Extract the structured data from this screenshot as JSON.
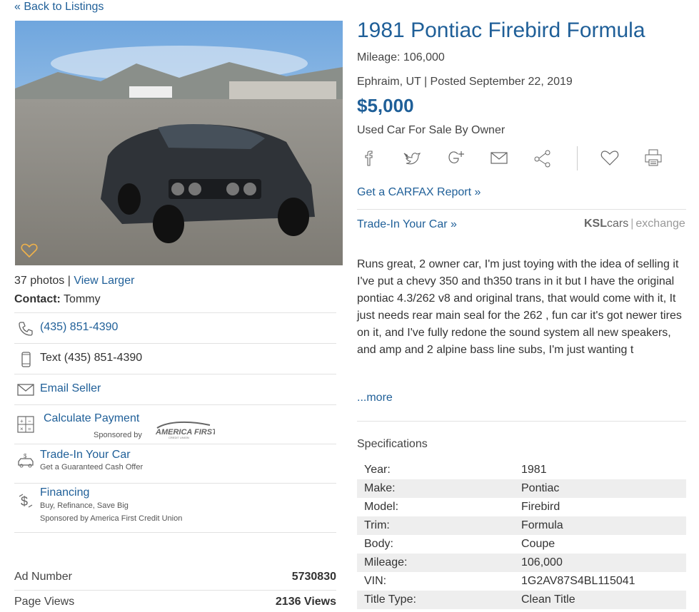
{
  "nav": {
    "back_label": "« Back to Listings"
  },
  "listing": {
    "title": "1981 Pontiac Firebird Formula",
    "mileage": "Mileage: 106,000",
    "location_posted": "Ephraim, UT | Posted September 22, 2019",
    "price": "$5,000",
    "sale_type": "Used Car For Sale By Owner"
  },
  "share": {
    "icons": [
      "facebook-icon",
      "twitter-icon",
      "google-plus-icon",
      "email-icon",
      "share-icon",
      "favorite-heart-icon",
      "print-icon"
    ]
  },
  "links": {
    "carfax": "Get a CARFAX Report »",
    "tradein": "Trade-In Your Car »",
    "partner_ksl": "KSL",
    "partner_cars": "cars",
    "partner_sep": "|",
    "partner_exchange": "exchange"
  },
  "description": "Runs great, 2 owner car, I'm just toying with the idea of selling it I've put a chevy 350 and th350 trans in it but I have the original pontiac 4.3/262 v8 and original trans, that would come with it, It just needs rear main seal for the 262 , fun car it's got newer tires on it, and I've fully redone the sound system all new speakers, and amp and 2 alpine bass line subs, I'm just wanting t",
  "more_label": "...more",
  "photos": {
    "count_text": "37 photos |",
    "view_larger": "View Larger"
  },
  "contact": {
    "label": "Contact:",
    "name": "Tommy",
    "phone": "(435) 851-4390",
    "text": "Text (435) 851-4390",
    "email": "Email Seller",
    "calc": "Calculate Payment",
    "sponsored_by": "Sponsored by",
    "sponsor_logo": "AMERICA FIRST",
    "sponsor_logo_sub": "CREDIT UNION",
    "trade_title": "Trade-In Your Car",
    "trade_sub": "Get a Guaranteed Cash Offer",
    "fin_title": "Financing",
    "fin_sub1": "Buy, Refinance, Save Big",
    "fin_sub2": "Sponsored by America First Credit Union"
  },
  "stats": {
    "ad_number_label": "Ad Number",
    "ad_number": "5730830",
    "views_label": "Page Views",
    "views": "2136 Views"
  },
  "specs": {
    "heading": "Specifications",
    "rows": [
      {
        "k": "Year:",
        "v": "1981"
      },
      {
        "k": "Make:",
        "v": "Pontiac"
      },
      {
        "k": "Model:",
        "v": "Firebird"
      },
      {
        "k": "Trim:",
        "v": "Formula"
      },
      {
        "k": "Body:",
        "v": "Coupe"
      },
      {
        "k": "Mileage:",
        "v": "106,000"
      },
      {
        "k": "VIN:",
        "v": "1G2AV87S4BL115041"
      },
      {
        "k": "Title Type:",
        "v": "Clean Title"
      }
    ]
  },
  "colors": {
    "link": "#1f5f98",
    "text": "#333333",
    "stripe": "#eeeeee",
    "heart": "#f0b24a"
  }
}
